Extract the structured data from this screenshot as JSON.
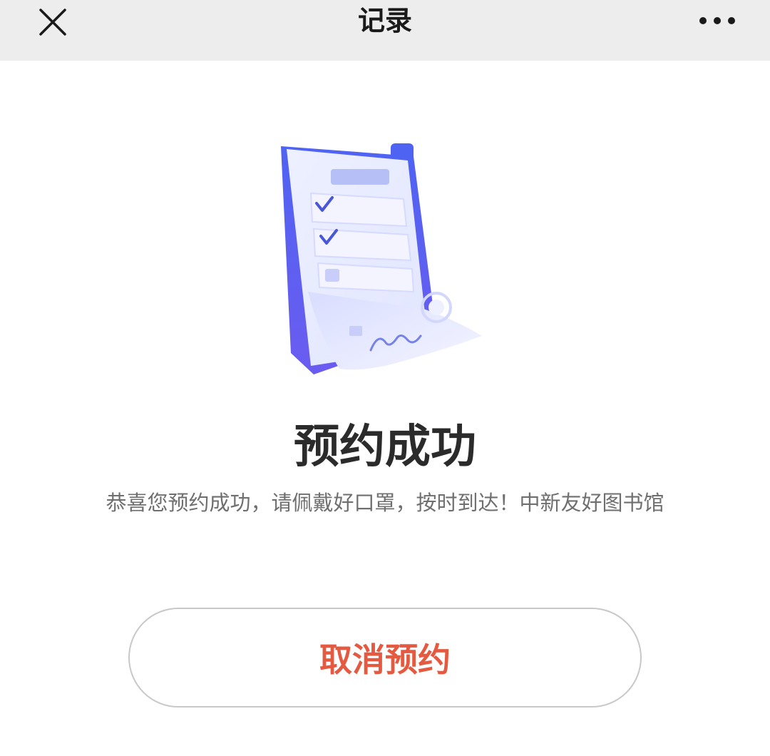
{
  "nav": {
    "title": "记录",
    "close_icon": "close-icon",
    "more_icon": "more-horizontal-icon"
  },
  "illustration": {
    "icon": "signed-document-checklist-illustration"
  },
  "result": {
    "title": "预约成功",
    "description": "恭喜您预约成功，请佩戴好口罩，按时到达！中新友好图书馆"
  },
  "actions": {
    "cancel_label": "取消预约"
  },
  "colors": {
    "nav_background": "#ededed",
    "accent_blue": "#5b6cf0",
    "cancel_text": "#e4593f",
    "title_text": "#2b2b2b",
    "description_text": "#6f6f6f"
  }
}
